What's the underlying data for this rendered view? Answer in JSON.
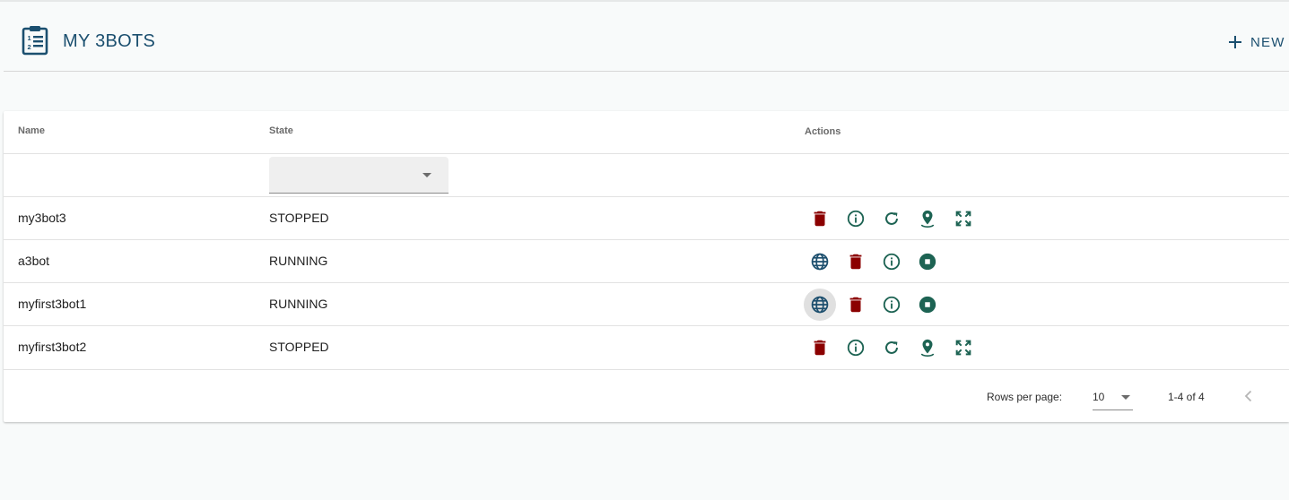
{
  "header": {
    "title": "MY 3BOTS",
    "icon": "clipboard-list-icon",
    "new_label": "NEW"
  },
  "table": {
    "columns": {
      "name": "Name",
      "state": "State",
      "actions": "Actions"
    },
    "state_filter": {
      "value": ""
    },
    "rows": [
      {
        "name": "my3bot3",
        "state": "STOPPED",
        "actions": [
          "delete-icon",
          "info-icon",
          "restart-icon",
          "location-icon",
          "expand-icon"
        ]
      },
      {
        "name": "a3bot",
        "state": "RUNNING",
        "actions": [
          "web-icon",
          "delete-icon",
          "info-icon",
          "stop-icon"
        ]
      },
      {
        "name": "myfirst3bot1",
        "state": "RUNNING",
        "actions": [
          "web-icon",
          "delete-icon",
          "info-icon",
          "stop-icon"
        ]
      },
      {
        "name": "myfirst3bot2",
        "state": "STOPPED",
        "actions": [
          "delete-icon",
          "info-icon",
          "restart-icon",
          "location-icon",
          "expand-icon"
        ]
      }
    ]
  },
  "pagination": {
    "rows_per_page_label": "Rows per page:",
    "rows_per_page_value": "10",
    "range": "1-4 of 4"
  },
  "colors": {
    "primary": "#1b4f6f",
    "action_green": "#1d6353",
    "delete_red": "#8b0000",
    "web_blue": "#1d4f6e"
  }
}
